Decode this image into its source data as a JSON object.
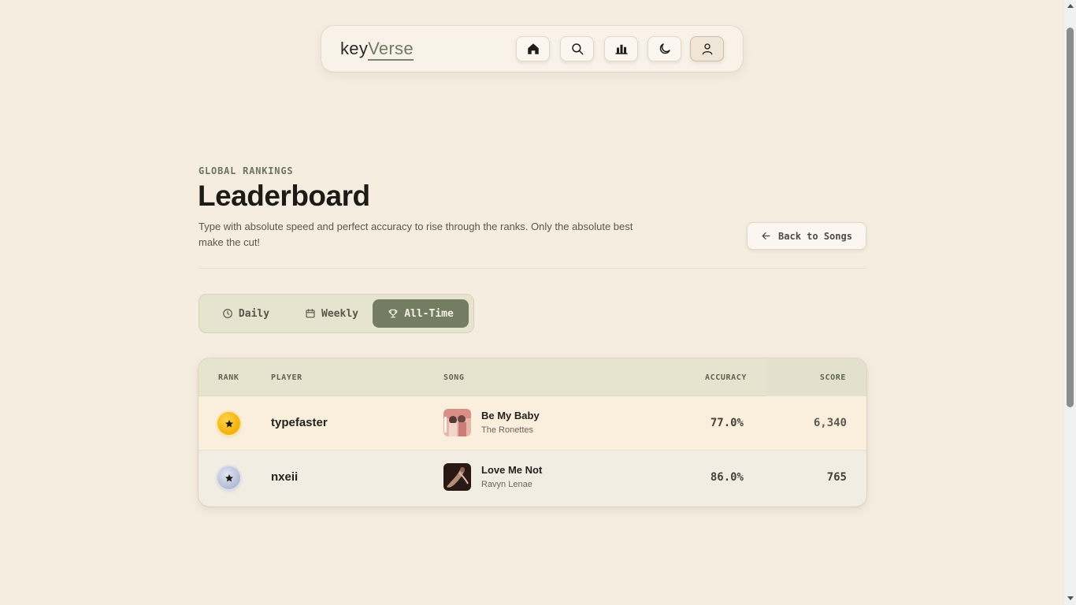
{
  "nav": {
    "logo_key": "key",
    "logo_verse": "Verse",
    "buttons": [
      {
        "icon": "home-icon"
      },
      {
        "icon": "search-icon"
      },
      {
        "icon": "stats-icon"
      },
      {
        "icon": "moon-icon"
      },
      {
        "icon": "user-icon"
      }
    ]
  },
  "header": {
    "eyebrow": "GLOBAL RANKINGS",
    "title": "Leaderboard",
    "description": "Type with absolute speed and perfect accuracy to rise through the ranks. Only the absolute best make the cut!",
    "back_label": "Back to Songs"
  },
  "tabs": [
    {
      "label": "Daily",
      "icon": "clock-icon"
    },
    {
      "label": "Weekly",
      "icon": "calendar-icon"
    },
    {
      "label": "All-Time",
      "icon": "trophy-icon",
      "active": true
    }
  ],
  "table": {
    "columns": [
      "RANK",
      "PLAYER",
      "SONG",
      "ACCURACY",
      "SCORE"
    ],
    "rows": [
      {
        "rank_badge": "gold",
        "player": "typefaster",
        "song_title": "Be My Baby",
        "song_artist": "The Ronettes",
        "accuracy": "77.0%",
        "score": "6,340"
      },
      {
        "rank_badge": "silver",
        "player": "nxeii",
        "song_title": "Love Me Not",
        "song_artist": "Ravyn Lenae",
        "accuracy": "86.0%",
        "score": "765"
      }
    ]
  },
  "colors": {
    "background": "#f5ede0",
    "accent": "#747c62",
    "gold": "#f2b00a",
    "silver": "#b3bcd4"
  }
}
